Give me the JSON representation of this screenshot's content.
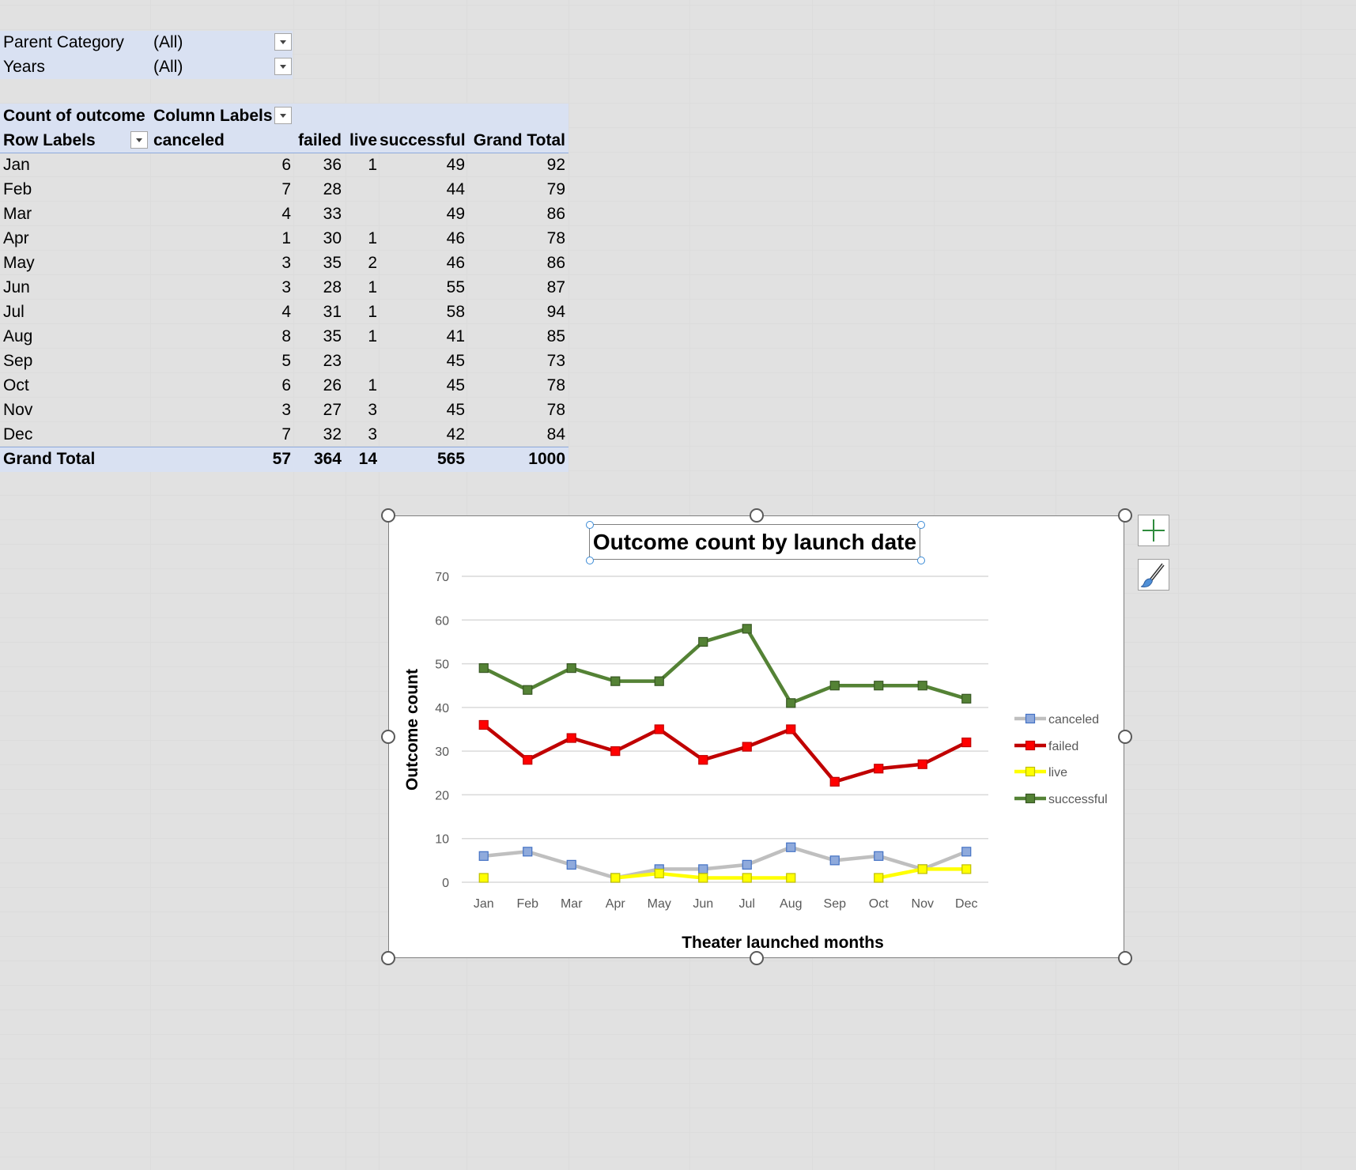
{
  "filters": [
    {
      "label": "Parent Category",
      "value": "(All)"
    },
    {
      "label": "Years",
      "value": "(All)"
    }
  ],
  "pivot": {
    "header1": {
      "left": "Count of outcome",
      "right": "Column Labels"
    },
    "header2": [
      "Row Labels",
      "canceled",
      "failed",
      "live",
      "successful",
      "Grand Total"
    ],
    "rows": [
      [
        "Jan",
        "6",
        "36",
        "1",
        "49",
        "92"
      ],
      [
        "Feb",
        "7",
        "28",
        "",
        "44",
        "79"
      ],
      [
        "Mar",
        "4",
        "33",
        "",
        "49",
        "86"
      ],
      [
        "Apr",
        "1",
        "30",
        "1",
        "46",
        "78"
      ],
      [
        "May",
        "3",
        "35",
        "2",
        "46",
        "86"
      ],
      [
        "Jun",
        "3",
        "28",
        "1",
        "55",
        "87"
      ],
      [
        "Jul",
        "4",
        "31",
        "1",
        "58",
        "94"
      ],
      [
        "Aug",
        "8",
        "35",
        "1",
        "41",
        "85"
      ],
      [
        "Sep",
        "5",
        "23",
        "",
        "45",
        "73"
      ],
      [
        "Oct",
        "6",
        "26",
        "1",
        "45",
        "78"
      ],
      [
        "Nov",
        "3",
        "27",
        "3",
        "45",
        "78"
      ],
      [
        "Dec",
        "7",
        "32",
        "3",
        "42",
        "84"
      ]
    ],
    "total": [
      "Grand Total",
      "57",
      "364",
      "14",
      "565",
      "1000"
    ]
  },
  "chart_data": {
    "type": "line",
    "title": "Outcome count by launch date",
    "xlabel": "Theater launched months",
    "ylabel": "Outcome count",
    "categories": [
      "Jan",
      "Feb",
      "Mar",
      "Apr",
      "May",
      "Jun",
      "Jul",
      "Aug",
      "Sep",
      "Oct",
      "Nov",
      "Dec"
    ],
    "ylim": [
      0,
      70
    ],
    "yticks": [
      0,
      10,
      20,
      30,
      40,
      50,
      60,
      70
    ],
    "grid": true,
    "legend_position": "right",
    "series": [
      {
        "name": "canceled",
        "color": "#bfbfbf",
        "marker_color": "#8faadc",
        "marker_stroke": "#4472c4",
        "values": [
          6,
          7,
          4,
          1,
          3,
          3,
          4,
          8,
          5,
          6,
          3,
          7
        ]
      },
      {
        "name": "failed",
        "color": "#c00000",
        "marker_color": "#ff0000",
        "marker_stroke": "#c00000",
        "values": [
          36,
          28,
          33,
          30,
          35,
          28,
          31,
          35,
          23,
          26,
          27,
          32
        ]
      },
      {
        "name": "live",
        "color": "#ffff00",
        "marker_color": "#ffff00",
        "marker_stroke": "#bfbf00",
        "values": [
          1,
          null,
          null,
          1,
          2,
          1,
          1,
          1,
          null,
          1,
          3,
          3
        ]
      },
      {
        "name": "successful",
        "color": "#548235",
        "marker_color": "#548235",
        "marker_stroke": "#385723",
        "values": [
          49,
          44,
          49,
          46,
          46,
          55,
          58,
          41,
          45,
          45,
          45,
          42
        ]
      }
    ]
  }
}
